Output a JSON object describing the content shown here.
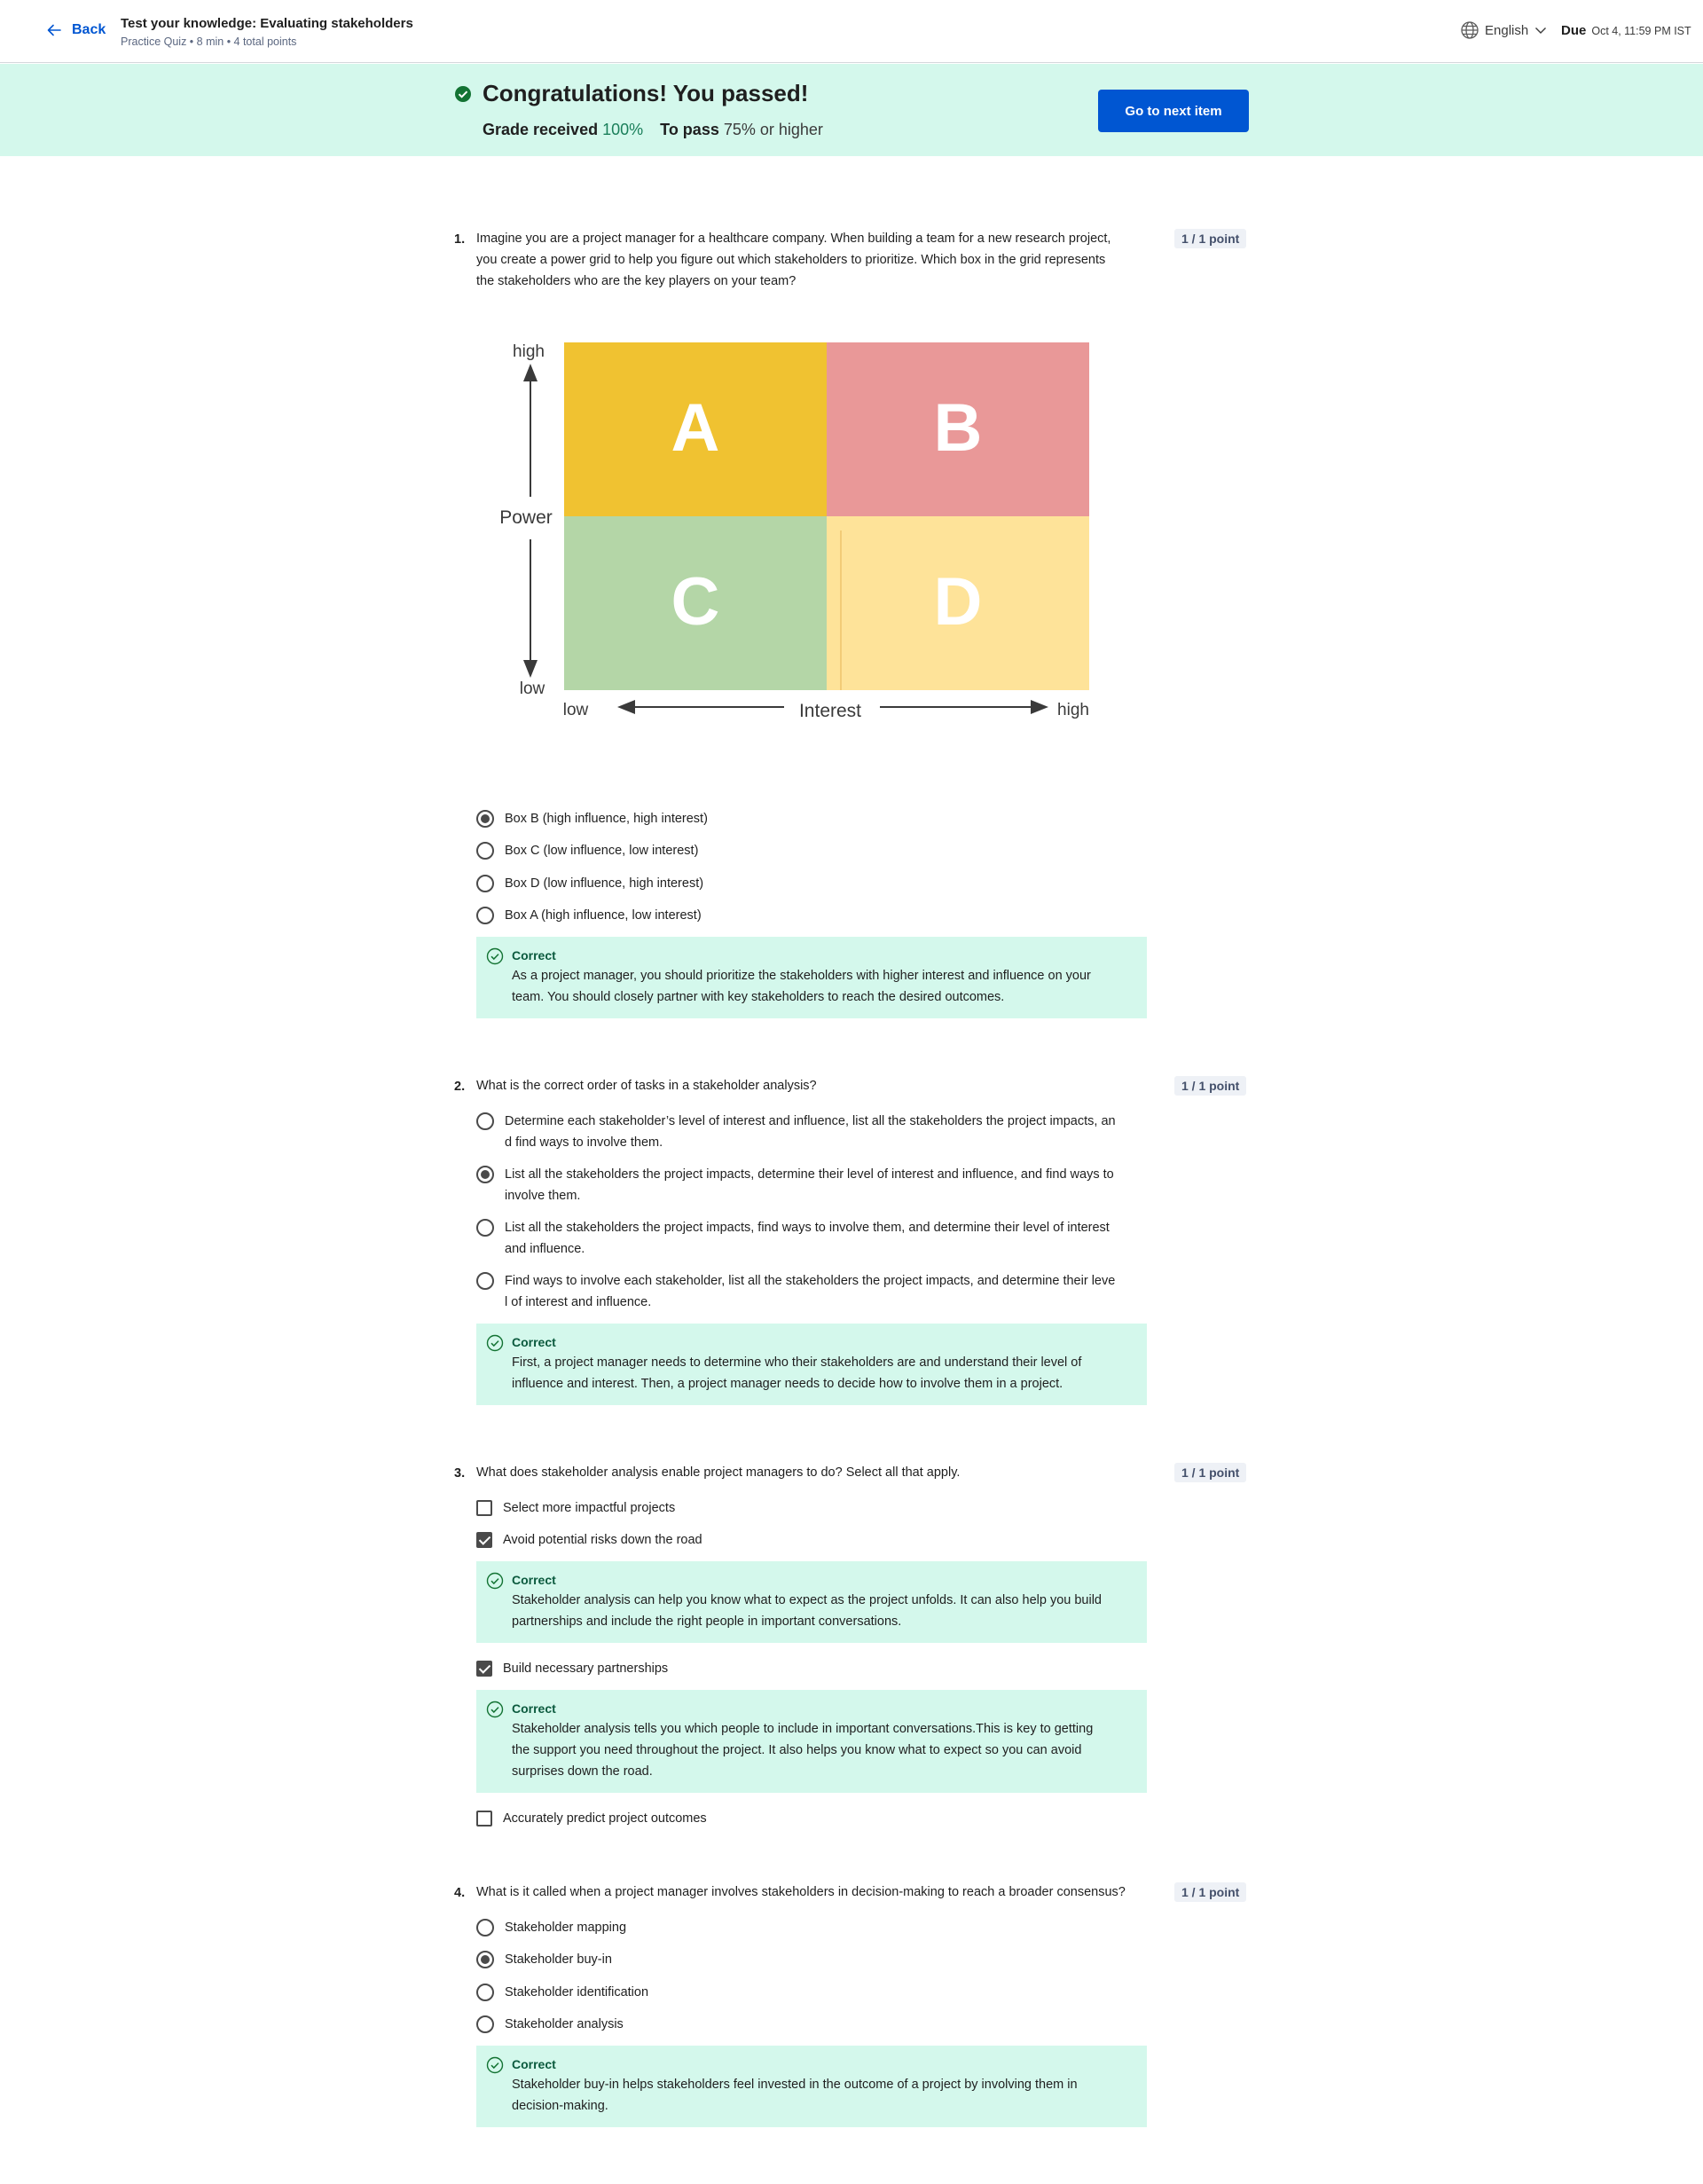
{
  "header": {
    "back_label": "Back",
    "title": "Test your knowledge: Evaluating stakeholders",
    "subtitle": "Practice Quiz • 8 min • 4 total points",
    "language": "English",
    "due_label": "Due",
    "due_date": "Oct 4, 11:59 PM IST"
  },
  "banner": {
    "heading": "Congratulations! You passed!",
    "grade_label": "Grade received",
    "grade_value": "100%",
    "pass_label": "To pass",
    "pass_value": "75% or higher",
    "next_button": "Go to next item",
    "accent": "#0056d2",
    "success_bg": "#d4f8ec"
  },
  "questions": [
    {
      "number": "1.",
      "text_lines": [
        "Imagine you are a project manager for a healthcare company. When building a team for a new research project,",
        "you create a power grid to help you figure out which stakeholders to prioritize. Which box in the grid represents",
        "the stakeholders who are the key players on your team?"
      ],
      "points": "1 / 1 point",
      "grid": {
        "boxes": [
          "A",
          "B",
          "C",
          "D"
        ],
        "colors": [
          "#f0c231",
          "#e99898",
          "#b4d6a7",
          "#fee399"
        ],
        "y_axis": {
          "label": "Power",
          "high": "high",
          "low": "low"
        },
        "x_axis": {
          "label": "Interest",
          "low": "low",
          "high": "high"
        }
      },
      "options": [
        {
          "label": "Box B (high influence, high interest)",
          "selected": true
        },
        {
          "label": "Box C (low influence, low interest)",
          "selected": false
        },
        {
          "label": "Box D (low influence, high interest)",
          "selected": false
        },
        {
          "label": "Box A (high influence, low interest)",
          "selected": false
        }
      ],
      "feedback": {
        "title": "Correct",
        "lines": [
          "As a project manager, you should prioritize the stakeholders with higher interest and influence on your",
          "team. You should closely partner with key stakeholders to reach the desired outcomes."
        ]
      }
    },
    {
      "number": "2.",
      "text_lines": [
        "What is the correct order of tasks in a stakeholder analysis?"
      ],
      "points": "1 / 1 point",
      "options": [
        {
          "lines": [
            "Determine each stakeholder’s level of interest and influence, list all the stakeholders the project impacts, an",
            "d find ways to involve them."
          ],
          "selected": false
        },
        {
          "lines": [
            "List all the stakeholders the project impacts, determine their level of interest and influence, and find ways to",
            "involve them."
          ],
          "selected": true
        },
        {
          "lines": [
            "List all the stakeholders the project impacts, find ways to involve them, and determine their level of interest",
            "and influence."
          ],
          "selected": false
        },
        {
          "lines": [
            "Find ways to involve each stakeholder, list all the stakeholders the project impacts, and determine their leve",
            "l of interest and influence."
          ],
          "selected": false
        }
      ],
      "feedback": {
        "title": "Correct",
        "lines": [
          "First, a project manager needs to determine who their stakeholders are and understand their level of",
          "influence and interest. Then, a project manager needs to decide how to involve them in a project."
        ]
      }
    },
    {
      "number": "3.",
      "text_lines": [
        "What does stakeholder analysis enable project managers to do? Select all that apply."
      ],
      "points": "1 / 1 point",
      "options": [
        {
          "label": "Select more impactful projects",
          "checked": false
        },
        {
          "label": "Avoid potential risks down the road",
          "checked": true
        },
        {
          "label": "Build necessary partnerships",
          "checked": true
        },
        {
          "label": "Accurately predict project outcomes",
          "checked": false
        }
      ],
      "feedbacks": [
        {
          "title": "Correct",
          "lines": [
            "Stakeholder analysis can help you know what to expect as the project unfolds. It can also help you build",
            "partnerships and include the right people in important conversations."
          ]
        },
        {
          "title": "Correct",
          "lines": [
            "Stakeholder analysis tells you which people to include in important conversations.This is key to getting",
            "the support you need throughout the project. It also helps you know what to expect so you can avoid",
            "surprises down the road."
          ]
        }
      ]
    },
    {
      "number": "4.",
      "text_lines": [
        "What is it called when a project manager involves stakeholders in decision-making to reach a broader consensus?"
      ],
      "points": "1 / 1 point",
      "options": [
        {
          "label": "Stakeholder mapping",
          "selected": false
        },
        {
          "label": "Stakeholder buy-in",
          "selected": true
        },
        {
          "label": "Stakeholder identification",
          "selected": false
        },
        {
          "label": "Stakeholder analysis",
          "selected": false
        }
      ],
      "feedback": {
        "title": "Correct",
        "lines": [
          "Stakeholder buy-in helps stakeholders feel invested in the outcome of a project by involving them in",
          "decision-making."
        ]
      }
    }
  ]
}
